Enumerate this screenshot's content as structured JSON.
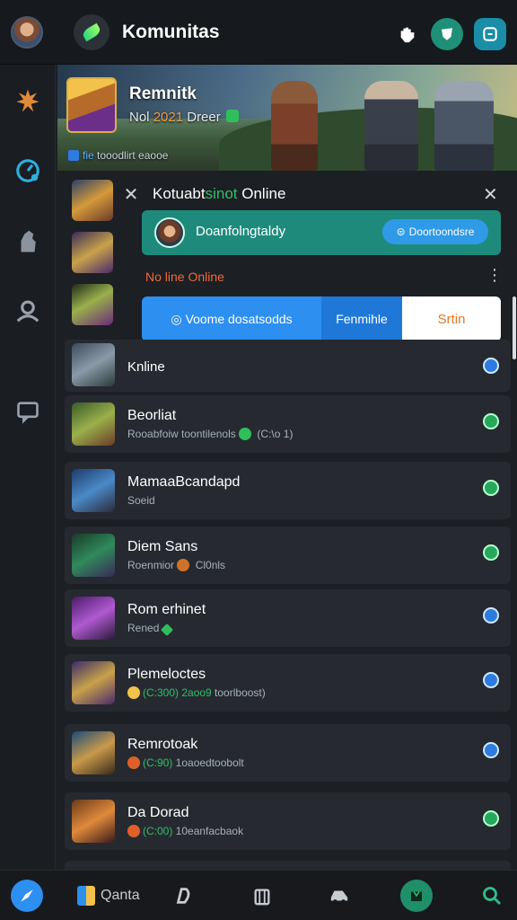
{
  "header": {
    "title": "Komunitas",
    "icons": [
      "avatar",
      "app-logo-icon",
      "hand-icon",
      "shield-icon",
      "sync-icon"
    ]
  },
  "rail": {
    "icons": [
      "splat-icon",
      "compass-icon",
      "character-icon",
      "person-icon",
      "chat-icon"
    ]
  },
  "banner": {
    "name": "Remnitk",
    "sub_prefix": "Nol ",
    "sub_number": "2021",
    "sub_suffix": " Dreer",
    "link_prefix": "f",
    "link_highlight": "fie",
    "link_text": " tooodlirt eaooe"
  },
  "popup": {
    "heading_prefix": "Kotuabt",
    "heading_green": "sinot",
    "heading_suffix": " Online",
    "friend_name": "Doanfolngtaldy",
    "friend_button": "Doortoondsre",
    "offline_label": "No line Online",
    "segments": [
      "Voome dosatsodds",
      "Fenmihle",
      "Srtin"
    ]
  },
  "online_label": "Knline",
  "rows": [
    {
      "name": "Beorliat",
      "sub": "Rooabfoiw toontilenols",
      "sub_tail": " (C:\\o 1)",
      "status": "green"
    },
    {
      "name": "MamaaBcandapd",
      "sub": "Soeid",
      "sub_tail": "",
      "status": "green"
    },
    {
      "name": "Diem Sans",
      "sub": "Roenmior",
      "sub_tail": " Cl0nls",
      "status": "green"
    },
    {
      "name": "Rom erhinet",
      "sub": "Rened",
      "sub_tail": "",
      "status": "blue"
    },
    {
      "name": "Plemeloctes",
      "sub_green": "(C:300) 2aoo9",
      "sub": " toorlboost)",
      "sub_tail": "",
      "status": "blue"
    },
    {
      "name": "Remrotoak",
      "sub_green": "(C:90)",
      "sub": " 1oaoedtoobolt",
      "sub_tail": "",
      "status": "blue"
    },
    {
      "name": "Da Dorad",
      "sub_green": "(C:00)",
      "sub": " 10eanfacbaok",
      "sub_tail": "",
      "status": "green"
    }
  ],
  "bottom_nav": {
    "label": "Qanta",
    "icons": [
      "compass-nav-icon",
      "book-icon",
      "d-logo-icon",
      "bag-icon",
      "vehicle-icon",
      "shop-icon",
      "search-icon"
    ]
  },
  "colors": {
    "accent_blue": "#2d8ff0",
    "teal": "#1e8a7c",
    "offline_orange": "#f06a3a",
    "online_green": "#2fbf6a"
  }
}
